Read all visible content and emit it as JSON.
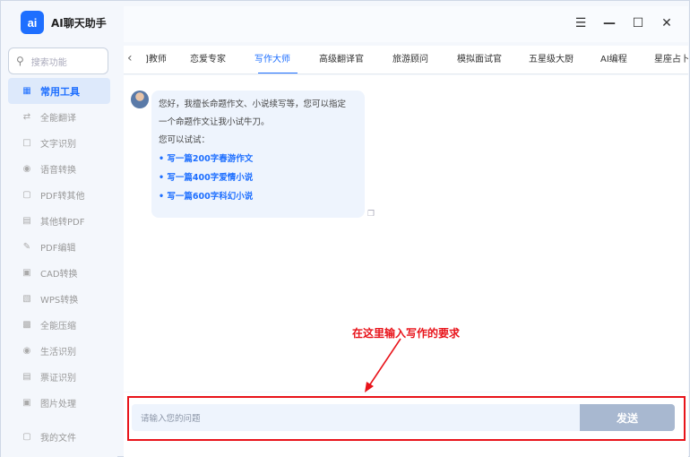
{
  "app": {
    "logo": "ai",
    "title": "AI聊天助手"
  },
  "search": {
    "placeholder": "搜索功能"
  },
  "sidebar": {
    "items": [
      {
        "label": "常用工具",
        "icon": "dashboard-icon",
        "active": true
      },
      {
        "label": "全能翻译",
        "icon": "translate-icon"
      },
      {
        "label": "文字识别",
        "icon": "scan-text-icon"
      },
      {
        "label": "语音转换",
        "icon": "audio-icon"
      },
      {
        "label": "PDF转其他",
        "icon": "pdf-icon"
      },
      {
        "label": "其他转PDF",
        "icon": "file-convert-icon"
      },
      {
        "label": "PDF编辑",
        "icon": "pdf-edit-icon"
      },
      {
        "label": "CAD转换",
        "icon": "cad-icon"
      },
      {
        "label": "WPS转换",
        "icon": "wps-icon"
      },
      {
        "label": "全能压缩",
        "icon": "compress-icon"
      },
      {
        "label": "生活识别",
        "icon": "camera-icon"
      },
      {
        "label": "票证识别",
        "icon": "ticket-icon"
      },
      {
        "label": "图片处理",
        "icon": "image-icon"
      }
    ],
    "bottom": {
      "label": "我的文件",
      "icon": "folder-icon"
    }
  },
  "tabs": [
    {
      "label": "]教师"
    },
    {
      "label": "恋爱专家"
    },
    {
      "label": "写作大师",
      "active": true
    },
    {
      "label": "高级翻译官"
    },
    {
      "label": "旅游顾问"
    },
    {
      "label": "模拟面试官"
    },
    {
      "label": "五星级大厨"
    },
    {
      "label": "AI编程"
    },
    {
      "label": "星座占卜"
    }
  ],
  "chat": {
    "greeting_line1": "您好，我擅长命题作文、小说续写等，您可以指定",
    "greeting_line2": "一个命题作文让我小试牛刀。",
    "try_label": "您可以试试：",
    "suggestions": [
      "写一篇200字春游作文",
      "写一篇400字爱情小说",
      "写一篇600字科幻小说"
    ]
  },
  "annotation": {
    "text": "在这里输入写作的要求",
    "color": "#e8131a"
  },
  "input": {
    "placeholder": "请输入您的问题",
    "send_label": "发送"
  },
  "colors": {
    "accent": "#1e6fff",
    "sidebar_active_bg": "#dde9fb",
    "send_button": "#a8b8d0"
  }
}
